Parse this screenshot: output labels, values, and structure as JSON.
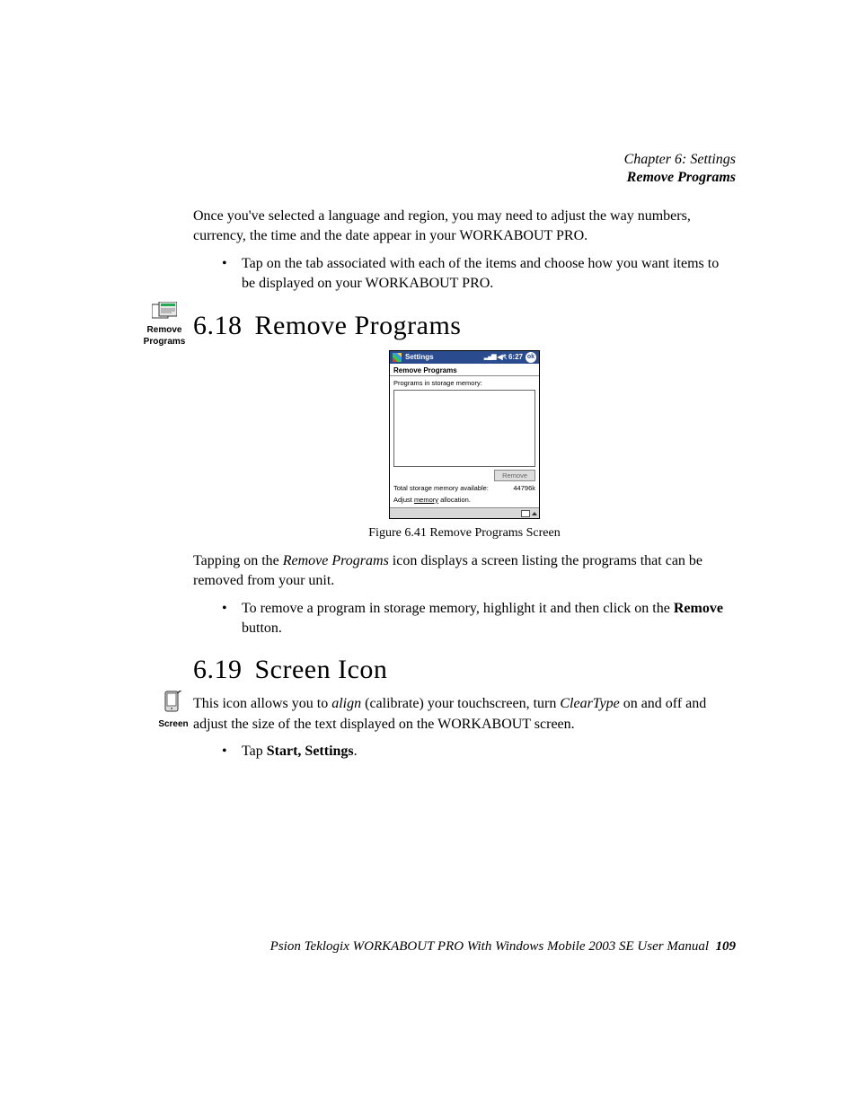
{
  "header": {
    "chapter": "Chapter  6:  Settings",
    "section": "Remove Programs"
  },
  "intro": {
    "p1": "Once you've selected a language and region, you may need to adjust the way numbers, currency, the time and the date appear in your WORKABOUT PRO.",
    "bullet1": "Tap on the tab associated with each of the items and choose how you want items to be displayed on your WORKABOUT PRO."
  },
  "s618": {
    "margin_label": "Remove Programs",
    "num": "6.18",
    "title": "Remove Programs",
    "caption": "Figure 6.41 Remove Programs Screen",
    "p1_a": "Tapping on the ",
    "p1_em": "Remove Programs",
    "p1_b": " icon displays a screen listing the programs that can be removed from your unit.",
    "bullet_a": "To remove a program in storage memory, highlight it and then click on the ",
    "bullet_strong": "Remove",
    "bullet_b": " button."
  },
  "s619": {
    "margin_label": "Screen",
    "num": "6.19",
    "title": "Screen Icon",
    "p1_a": "This icon allows you to ",
    "p1_em1": "align",
    "p1_b": " (calibrate) your touchscreen, turn ",
    "p1_em2": "ClearType",
    "p1_c": " on and off and adjust the size of the text displayed on the WORKABOUT screen.",
    "bullet_a": "Tap ",
    "bullet_strong": "Start, Settings",
    "bullet_b": "."
  },
  "shot": {
    "title": "Settings",
    "signal": "▂▄▆",
    "vol": "◀ৎ",
    "time": "6:27",
    "ok": "ok",
    "tab": "Remove Programs",
    "label": "Programs in storage memory:",
    "remove_btn": "Remove",
    "total_label": "Total storage memory available:",
    "total_value": "44796k",
    "link_a": "Adjust ",
    "link_u": "memory",
    "link_b": " allocation."
  },
  "footer": {
    "text": "Psion Teklogix WORKABOUT PRO With Windows Mobile 2003 SE User Manual",
    "page": "109"
  }
}
